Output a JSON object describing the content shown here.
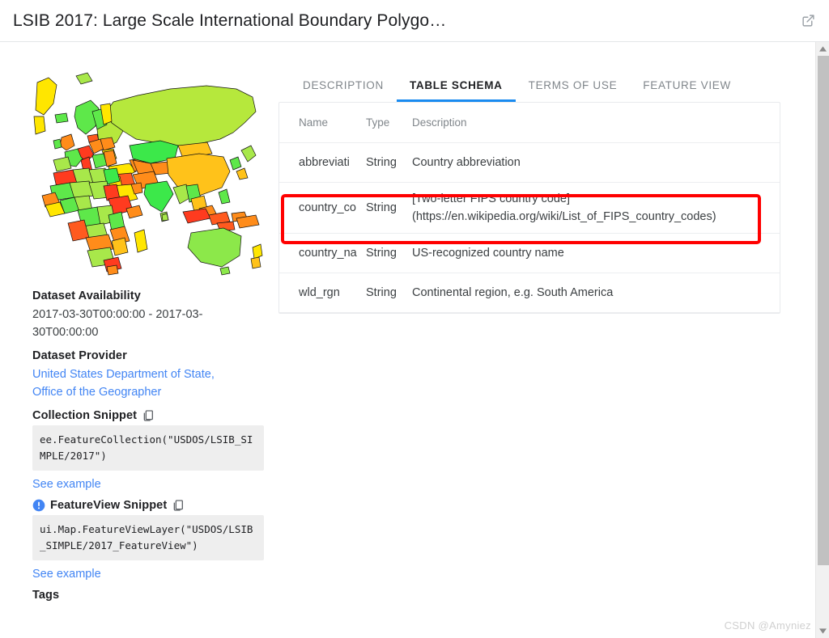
{
  "window": {
    "title": "LSIB 2017: Large Scale International Boundary Polygo…",
    "open_external_icon": "open-in-new-icon"
  },
  "tabs": [
    {
      "label": "DESCRIPTION",
      "active": false
    },
    {
      "label": "TABLE SCHEMA",
      "active": true
    },
    {
      "label": "TERMS OF USE",
      "active": false
    },
    {
      "label": "FEATURE VIEW",
      "active": false
    }
  ],
  "schema": {
    "columns": [
      "Name",
      "Type",
      "Description"
    ],
    "rows": [
      {
        "name": "abbreviati",
        "type": "String",
        "description_line1": "Country abbreviation",
        "description_line2": ""
      },
      {
        "name": "country_co",
        "type": "String",
        "description_line1": "[Two-letter FIPS country code]",
        "description_line2": "(https://en.wikipedia.org/wiki/List_of_FIPS_country_codes)",
        "highlighted": true
      },
      {
        "name": "country_na",
        "type": "String",
        "description_line1": "US-recognized country name",
        "description_line2": ""
      },
      {
        "name": "wld_rgn",
        "type": "String",
        "description_line1": "Continental region, e.g. South America",
        "description_line2": ""
      }
    ]
  },
  "sidebar": {
    "thumbnail_name": "dataset-world-map-thumbnail",
    "availability_title": "Dataset Availability",
    "availability_value": "2017-03-30T00:00:00 - 2017-03-30T00:00:00",
    "provider_title": "Dataset Provider",
    "provider_link": "United States Department of State, Office of the Geographer",
    "collection_snippet_title": "Collection Snippet",
    "collection_snippet_code": "ee.FeatureCollection(\"USDOS/LSIB_SIMPLE/2017\")",
    "collection_see_example": "See example",
    "featureview_snippet_title": "FeatureView Snippet",
    "featureview_snippet_code": "ui.Map.FeatureViewLayer(\"USDOS/LSIB_SIMPLE/2017_FeatureView\")",
    "featureview_see_example": "See example",
    "tags_title": "Tags",
    "copy_icon": "copy-icon",
    "badge_icon": "info-badge-icon"
  },
  "colors": {
    "accent_blue": "#1a8bf0",
    "link_blue": "#4285f4",
    "highlight_red": "#ff0000",
    "snippet_bg": "#eeeeee",
    "text_primary": "#202124",
    "text_secondary": "#80868b"
  },
  "scrollbar": {
    "up_arrow": "scroll-up-arrow-icon",
    "down_arrow": "scroll-down-arrow-icon"
  },
  "watermark": "CSDN @Amyniez"
}
